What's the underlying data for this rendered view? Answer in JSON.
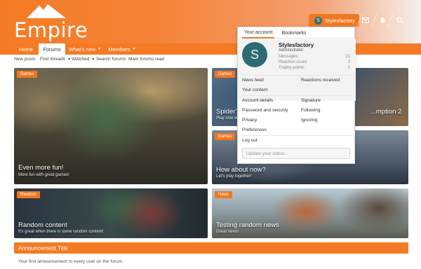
{
  "header": {
    "logo_text": "Empire",
    "user_initial": "S",
    "username": "Stylesfactory"
  },
  "nav": {
    "items": [
      {
        "label": "Home"
      },
      {
        "label": "Forums"
      },
      {
        "label": "What's new"
      },
      {
        "label": "Members"
      }
    ],
    "sub_items": [
      "New posts",
      "Find threads",
      "Watched",
      "Search forums",
      "Mark forums read"
    ]
  },
  "cards": [
    {
      "tag": "Games",
      "title": "Even more fun!",
      "subtitle": "More fun with great games!"
    },
    {
      "tag": "Games",
      "title": "Spider?",
      "subtitle": "Play now wi..."
    },
    {
      "tag": "",
      "title": "...mption 2",
      "subtitle": ""
    },
    {
      "tag": "Games",
      "title": "How about now?",
      "subtitle": "Let's play together!"
    },
    {
      "tag": "Random",
      "title": "Random content",
      "subtitle": "It's great when there is some random content!"
    },
    {
      "tag": "News",
      "title": "Testing random news",
      "subtitle": "Great news!"
    }
  ],
  "announcement": {
    "title": "Announcement Title",
    "text": "Your first announcement to every user on the forum."
  },
  "account_menu": {
    "tabs": [
      "Your account",
      "Bookmarks"
    ],
    "avatar_initial": "S",
    "name": "Stylesfactory",
    "role": "Administrator",
    "stats": [
      {
        "label": "Messages:",
        "value": "21"
      },
      {
        "label": "Reaction score:",
        "value": "0"
      },
      {
        "label": "Trophy points:",
        "value": "1"
      }
    ],
    "links_left": [
      "News feed",
      "Your content",
      "Account details",
      "Password and security",
      "Privacy",
      "Preferences",
      "Log out"
    ],
    "links_right": [
      "Reactions received",
      "Signature",
      "Following",
      "Ignoring"
    ],
    "status_placeholder": "Update your status..."
  },
  "colors": {
    "accent": "#f47b24",
    "avatar": "#2d6a74"
  }
}
